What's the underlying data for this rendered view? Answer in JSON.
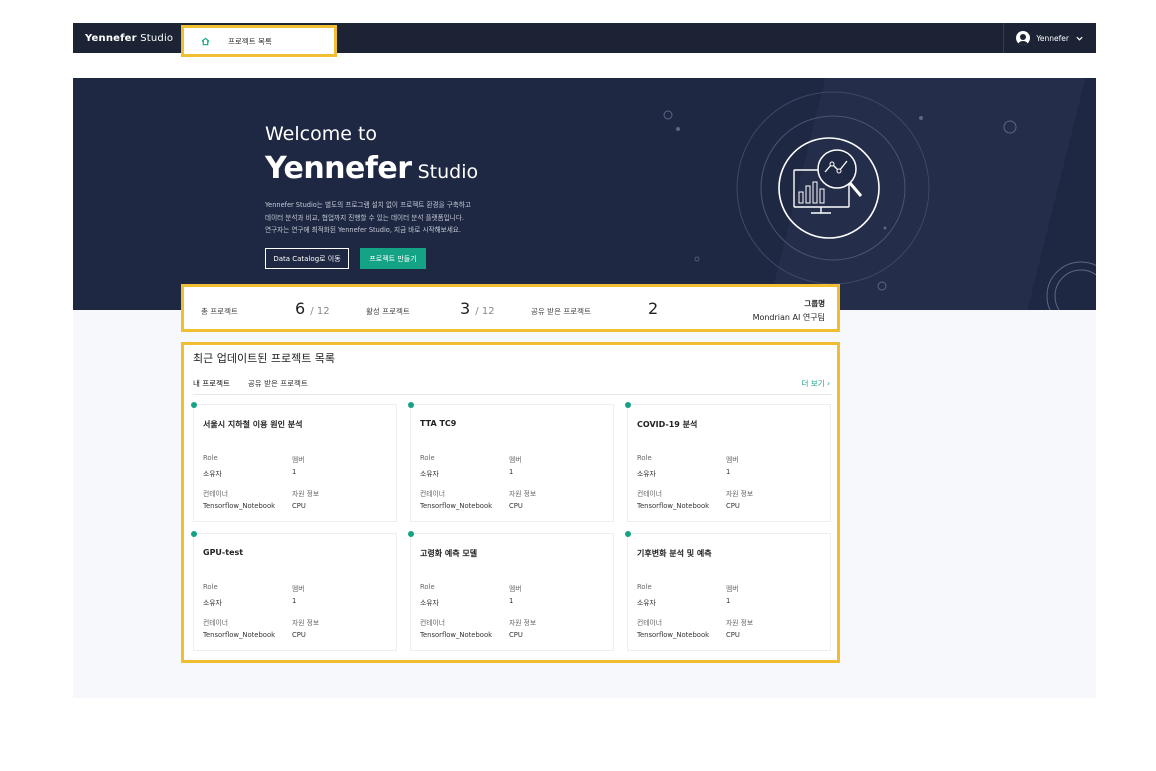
{
  "app": {
    "brand_logo": "Yennefer",
    "brand_suffix": "Studio"
  },
  "user": {
    "name": "Yennefer",
    "icon": "account-circle-icon"
  },
  "breadcrumb": {
    "home_icon": "home-icon",
    "current": "프로젝트 목록"
  },
  "hero": {
    "welcome": "Welcome to",
    "logo": "Yennefer",
    "studio": "Studio",
    "desc_line1": "Yennefer Studio는 별도의 프로그램 설치 없이 프로젝트 환경을 구축하고",
    "desc_line2": "데이터 분석과 비교, 협업까지 진행할 수 있는 데이터 분석 플랫폼입니다.",
    "desc_line3": "연구자는 연구에 최적화된 Yennefer Studio, 지금 바로 시작해보세요.",
    "btn_catalog": "Data Catalog로 이동",
    "btn_create": "프로젝트 만들기"
  },
  "stats": {
    "total_label": "총 프로젝트",
    "total_value": "6",
    "total_max": "/ 12",
    "active_label": "활성 프로젝트",
    "active_value": "3",
    "active_max": "/ 12",
    "shared_label": "공유 받은 프로젝트",
    "shared_value": "2",
    "group_label": "그룹명",
    "group_value": "Mondrian AI 연구팀"
  },
  "recent": {
    "title": "최근 업데이트된 프로젝트 목록",
    "tab_mine": "내 프로젝트",
    "tab_shared": "공유 받은 프로젝트",
    "more": "더 보기",
    "labels": {
      "role": "Role",
      "member": "멤버",
      "container": "컨테이너",
      "resource": "자원 정보"
    },
    "cards": [
      {
        "title": "서울시 지하철 이용 원인 분석",
        "role": "소유자",
        "members": "1",
        "container": "Tensorflow_Notebook",
        "resource": "CPU"
      },
      {
        "title": "TTA TC9",
        "role": "소유자",
        "members": "1",
        "container": "Tensorflow_Notebook",
        "resource": "CPU"
      },
      {
        "title": "COVID-19 분석",
        "role": "소유자",
        "members": "1",
        "container": "Tensorflow_Notebook",
        "resource": "CPU"
      },
      {
        "title": "GPU-test",
        "role": "소유자",
        "members": "1",
        "container": "Tensorflow_Notebook",
        "resource": "CPU"
      },
      {
        "title": "고령화 예측 모델",
        "role": "소유자",
        "members": "1",
        "container": "Tensorflow_Notebook",
        "resource": "CPU"
      },
      {
        "title": "기후변화 분석 및 예측",
        "role": "소유자",
        "members": "1",
        "container": "Tensorflow_Notebook",
        "resource": "CPU"
      }
    ]
  },
  "colors": {
    "nav_bg": "#1b2335",
    "hero_bg": "#1f2842",
    "accent": "#14a385",
    "highlight": "#f0be32"
  }
}
